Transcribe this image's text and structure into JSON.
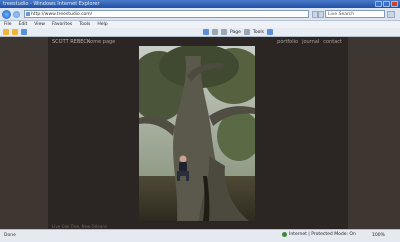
{
  "window": {
    "title": "treestudio - Windows Internet Explorer"
  },
  "address": {
    "url": "http://www.treestudio.com/",
    "search_placeholder": "Live Search"
  },
  "menu": [
    "File",
    "Edit",
    "View",
    "Favorites",
    "Tools",
    "Help"
  ],
  "toolbar": {
    "page_label": "Page",
    "tools_label": "Tools"
  },
  "site": {
    "title": "SCOTT REBECK",
    "home_link": "home page",
    "nav": [
      "portfolio",
      "journal",
      "contact"
    ],
    "caption": "Live Oak Tree, New Orleans"
  },
  "status": {
    "left": "Done",
    "zone": "Internet | Protected Mode: On",
    "zoom": "100%"
  }
}
